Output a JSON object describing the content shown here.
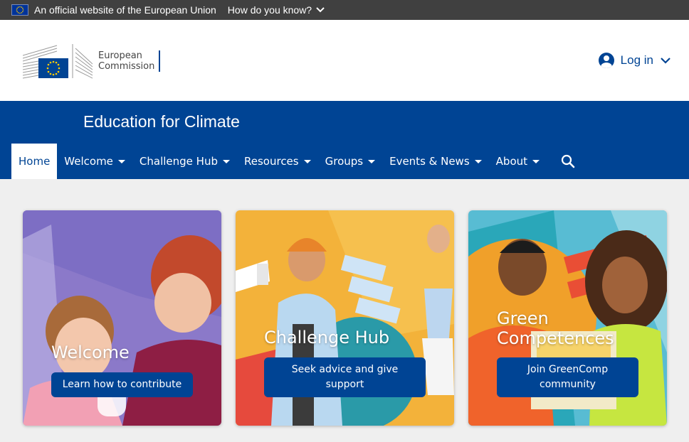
{
  "eu_banner": {
    "official_text": "An official website of the European Union",
    "how_text": "How do you know?"
  },
  "header": {
    "logo_line1": "European",
    "logo_line2": "Commission",
    "login_label": "Log in"
  },
  "site": {
    "title": "Education for Climate"
  },
  "nav": {
    "items": [
      {
        "label": "Home",
        "active": true
      },
      {
        "label": "Welcome"
      },
      {
        "label": "Challenge Hub"
      },
      {
        "label": "Resources"
      },
      {
        "label": "Groups"
      },
      {
        "label": "Events & News"
      },
      {
        "label": "About"
      }
    ]
  },
  "cards": [
    {
      "title": "Welcome",
      "button": "Learn how to contribute"
    },
    {
      "title": "Challenge Hub",
      "button": "Seek advice and give support"
    },
    {
      "title_line1": "Green",
      "title_line2": "Competences",
      "button": "Join GreenComp community"
    }
  ],
  "colors": {
    "eu_blue": "#004494",
    "banner_grey": "#404040",
    "page_bg": "#efefef"
  }
}
